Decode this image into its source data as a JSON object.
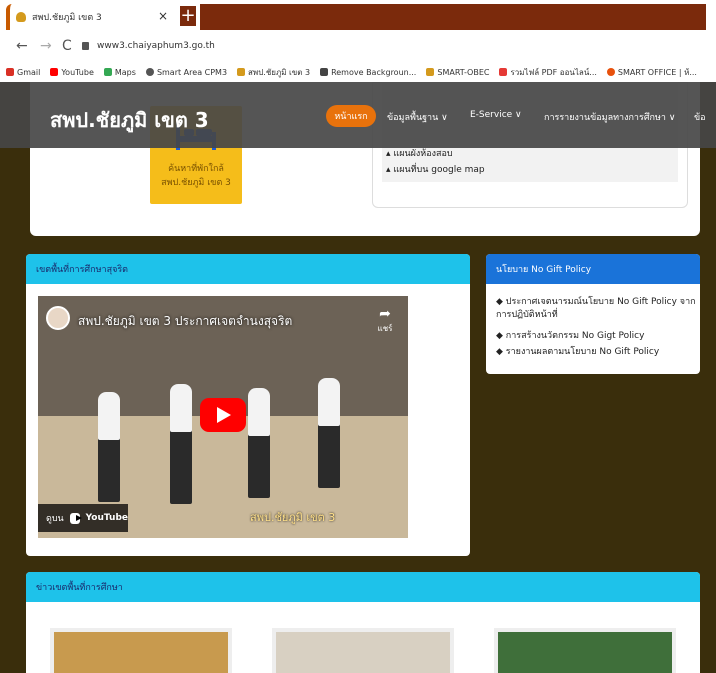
{
  "browser": {
    "tab_title": "สพป.ชัยภูมิ เขต 3",
    "tab_close": "×",
    "new_tab": "+",
    "url": "www3.chaiyaphum3.go.th",
    "bookmarks": [
      {
        "label": "Gmail",
        "color": "#d93025"
      },
      {
        "label": "YouTube",
        "color": "#ff0000"
      },
      {
        "label": "Maps",
        "color": "#34a853"
      },
      {
        "label": "Smart Area CPM3",
        "color": "#555555"
      },
      {
        "label": "สพป.ชัยภูมิ เขต 3",
        "color": "#d49a1d"
      },
      {
        "label": "Remove Backgroun...",
        "color": "#444444"
      },
      {
        "label": "SMART-OBEC",
        "color": "#d49a1d"
      },
      {
        "label": "รวมไฟล์ PDF ออนไลน์...",
        "color": "#e53935"
      },
      {
        "label": "SMART OFFICE | ห้...",
        "color": "#e8510c"
      }
    ]
  },
  "navbar": {
    "title": "สพป.ชัยภูมิ เขต 3",
    "items": [
      "หน้าแรก",
      "ข้อมูลพื้นฐาน ∨",
      "E-Service ∨",
      "การรายงานข้อมูลทางการศึกษา ∨",
      "ข้อ"
    ]
  },
  "top_card": {
    "hotel_label_1": "ค้นหาที่พักใกล้",
    "hotel_label_2": "สพป.ชัยภูมิ เขต 3",
    "links": [
      "แผนผังห้องสอบ",
      "แผนที่บน google map"
    ]
  },
  "video_card": {
    "heading": "เขตพื้นที่การศึกษาสุจริต",
    "video_title": "สพป.ชัยภูมิ เขต 3 ประกาศเจตจำนงสุจริต",
    "share_label": "แชร์",
    "watch_on": "ดูบน",
    "youtube": "YouTube",
    "caption": "สพป.ชัยภูมิ เขต 3"
  },
  "policy_card": {
    "heading": "นโยบาย No Gift Policy",
    "items": [
      "ประกาศเจตนารมณ์นโยบาย No Gift Policy จากการปฏิบัติหน้าที่",
      "การสร้างนวัตกรรม No Gigt Policy",
      "รายงานผลตามนโยบาย No Gift Policy"
    ]
  },
  "news_card": {
    "heading": "ข่าวเขตพื้นที่การศึกษา"
  },
  "colors": {
    "accent_orange": "#e8720c",
    "header_cyan": "#1ec2ea",
    "header_blue": "#1a73d9",
    "page_bg": "#3a2e0c"
  }
}
